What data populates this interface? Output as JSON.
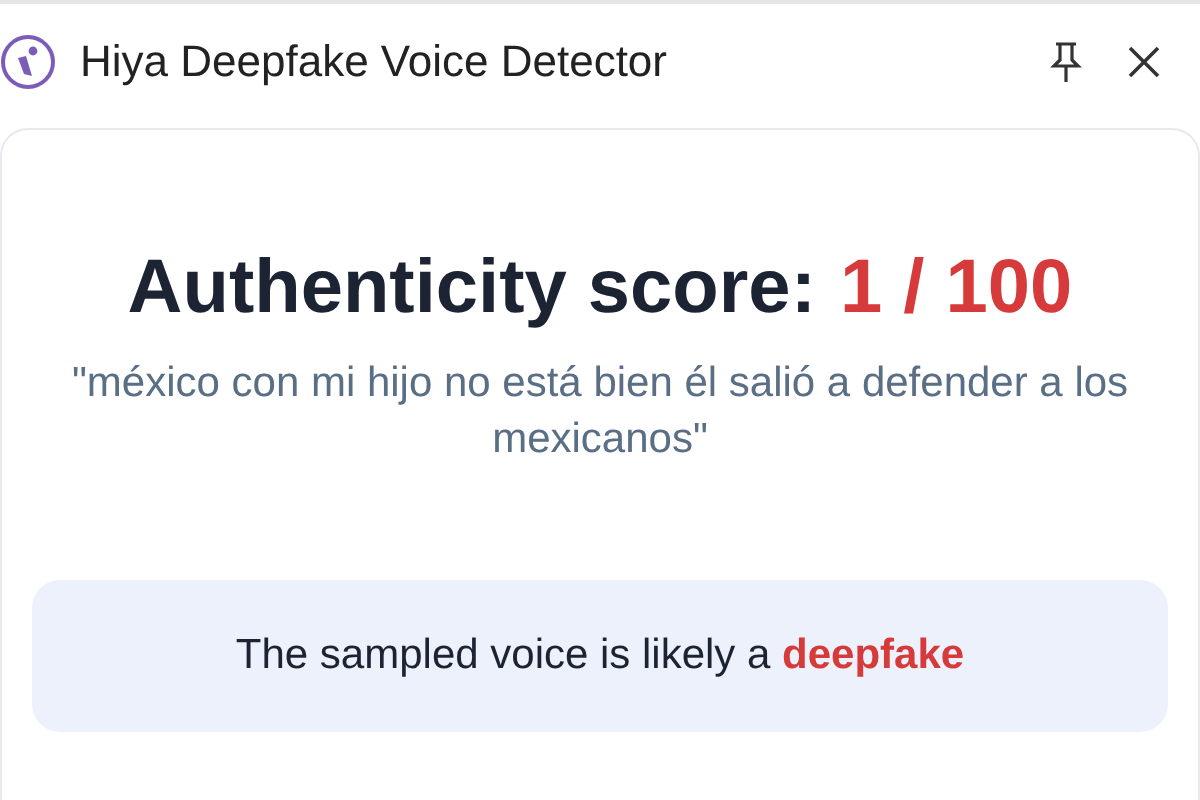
{
  "window": {
    "title": "Hiya Deepfake Voice Detector"
  },
  "score": {
    "label": "Authenticity score:",
    "value": "1 / 100"
  },
  "transcript": "\"méxico con mi hijo no está bien él salió a defender a los mexicanos\"",
  "verdict": "The sampled voice is likely a **deepfake**"
}
